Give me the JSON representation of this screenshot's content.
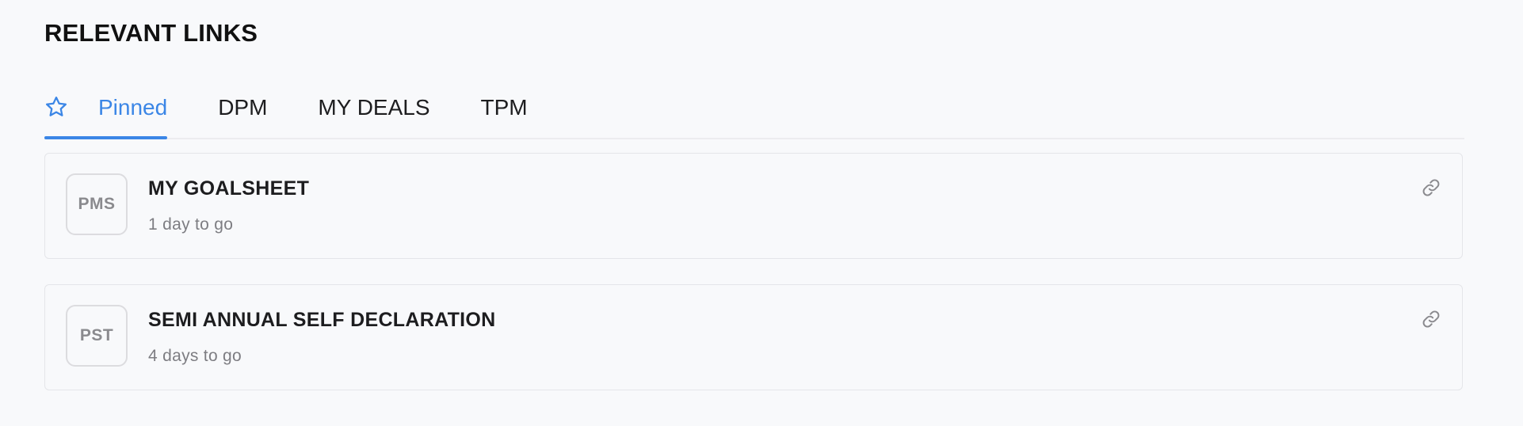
{
  "section": {
    "title": "RELEVANT LINKS"
  },
  "tabs": [
    {
      "label": "Pinned",
      "active": true,
      "icon": "star-icon"
    },
    {
      "label": "DPM",
      "active": false
    },
    {
      "label": "MY DEALS",
      "active": false
    },
    {
      "label": "TPM",
      "active": false
    }
  ],
  "links": [
    {
      "badge": "PMS",
      "title": "MY GOALSHEET",
      "subtitle": "1 day to go",
      "icon": "link-icon"
    },
    {
      "badge": "PST",
      "title": "SEMI ANNUAL SELF DECLARATION",
      "subtitle": "4 days to go",
      "icon": "link-icon"
    }
  ],
  "colors": {
    "accent": "#3b86e6",
    "background": "#f8f9fb",
    "border": "#e4e5e9",
    "muted_text": "#7d7d82"
  }
}
